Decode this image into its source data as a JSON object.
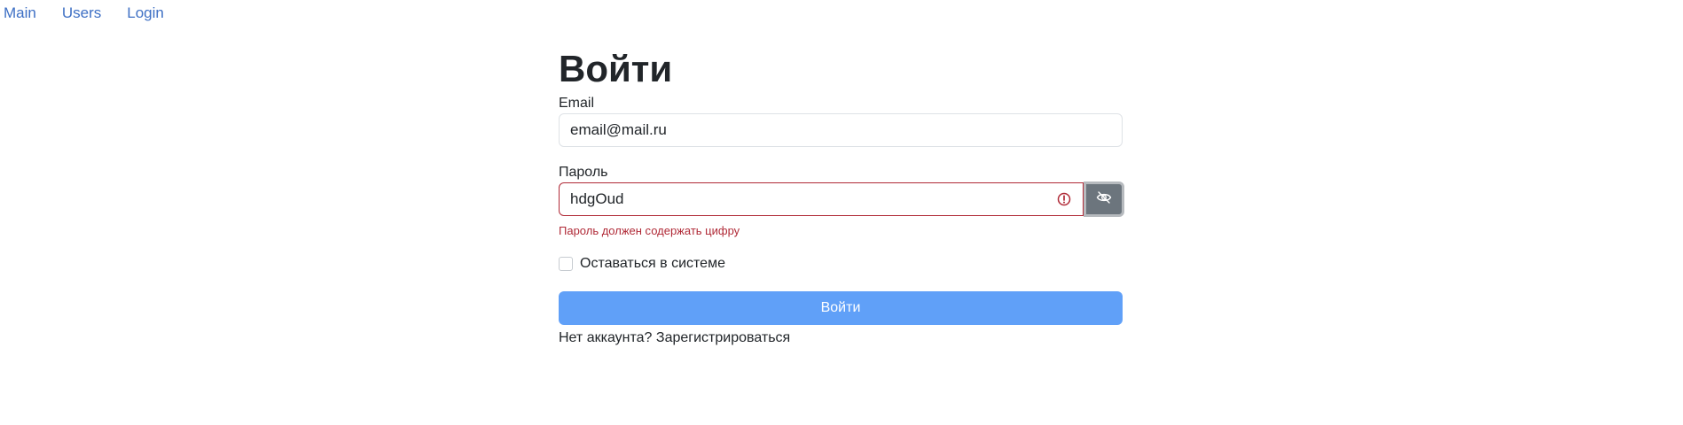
{
  "nav": {
    "items": [
      {
        "label": "Main"
      },
      {
        "label": "Users"
      },
      {
        "label": "Login"
      }
    ]
  },
  "form": {
    "title": "Войти",
    "email": {
      "label": "Email",
      "value": "email@mail.ru"
    },
    "password": {
      "label": "Пароль",
      "value": "hdgOud",
      "error": "Пароль должен содержать цифру",
      "warning_icon": "exclamation-circle-icon",
      "toggle_icon": "eye-slash-icon"
    },
    "remember": {
      "label": "Оставаться в системе",
      "checked": false
    },
    "submit_label": "Войти",
    "signup": {
      "prompt": "Нет аккаунта?",
      "link": "Зарегистрироваться"
    }
  },
  "colors": {
    "link": "#3d6fc4",
    "error": "#b02a37",
    "primary_button": "#60a0f8",
    "toggle_button": "#6c757d"
  }
}
